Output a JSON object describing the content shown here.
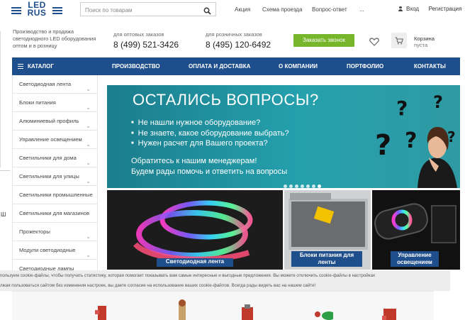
{
  "logo": {
    "line1": "LED",
    "line2": "RUS"
  },
  "search": {
    "placeholder": "Поиск по товарам"
  },
  "top_links": [
    "Акция",
    "Схема проезда",
    "Вопрос-ответ",
    "..."
  ],
  "auth": {
    "login": "Вход",
    "register": "Регистрация"
  },
  "company_description": "Производство и продажа светодиодного LED оборудования оптом и в розницу",
  "phones": [
    {
      "label": "для оптовых заказов",
      "number": "8 (499) 521-3426"
    },
    {
      "label": "для розничных заказов",
      "number": "8 (495) 120-6492"
    }
  ],
  "call_button": "Заказать звонок",
  "cart": {
    "label": "Корзина",
    "status": "пуста"
  },
  "nav": {
    "catalog": "КАТАЛОГ",
    "items": [
      "ПРОИЗВОДСТВО",
      "ОПЛАТА И ДОСТАВКА",
      "О КОМПАНИИ",
      "ПОРТФОЛИО",
      "КОНТАКТЫ"
    ]
  },
  "sidebar": {
    "items": [
      "Светодиодная лента",
      "Блоки питания",
      "Алюминиевый профиль",
      "Управление освещением",
      "Светильники для дома",
      "Светильники для улицы",
      "Светильники промышленные",
      "Светильники для магазинов",
      "Прожекторы",
      "Модули светодиодные",
      "Светодиодные лампы"
    ]
  },
  "banner": {
    "title": "ОСТАЛИСЬ ВОПРОСЫ?",
    "bullets": [
      "Не нашли нужное оборудование?",
      "Не знаете, какое оборудование выбрать?",
      "Нужен расчет для Вашего проекта?"
    ],
    "cta_line1": "Обратитесь к нашим менеджерам!",
    "cta_line2": "Будем рады помочь и ответить на вопросы",
    "slides_count": 7,
    "active_slide": 7
  },
  "tiles": [
    {
      "caption": "Светодиодная лента"
    },
    {
      "caption_line1": "Блоки питания для",
      "caption_line2": "ленты"
    },
    {
      "caption_line1": "Управление",
      "caption_line2": "освещением"
    }
  ],
  "cookie": {
    "line1": "пользуем cookie-файлы, чтобы получать статистику, которая помогает показывать вам самые интересные и выгодные предложения. Вы можете отключить cookie-файлы в настройках",
    "line2": "лжая пользоваться сайтом без изменения настроек, вы даете согласие на использование ваших cookie-файлов. Всегда рады видеть вас на нашем сайте!"
  },
  "edge_char": "Ш",
  "colors": {
    "brand_blue": "#1e4e8c",
    "call_green": "#77b52a",
    "banner_teal": "#25a0ad"
  }
}
